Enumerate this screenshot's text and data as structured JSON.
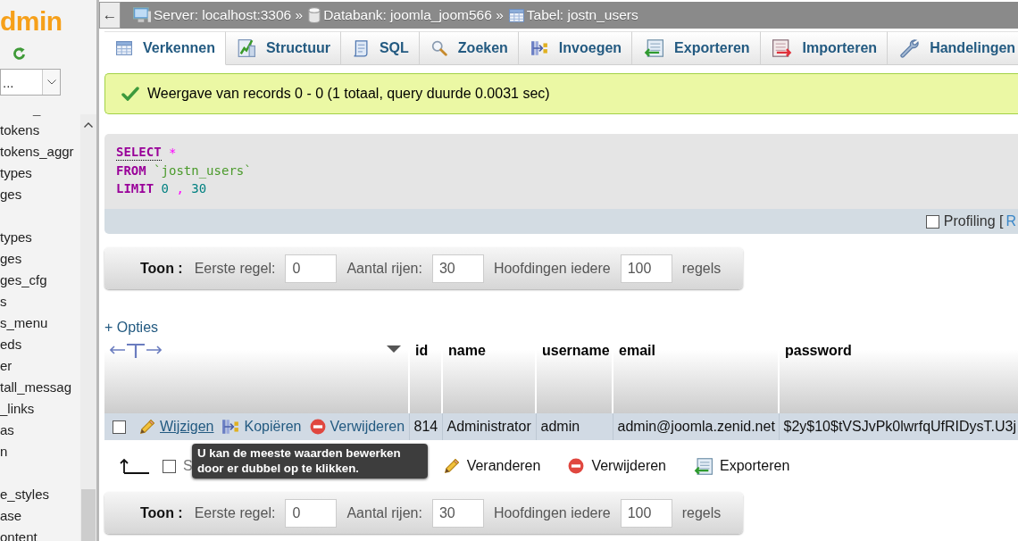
{
  "sidebar": {
    "logo": "dmin",
    "database_select": {
      "value": "..."
    },
    "tree_toggle": "_",
    "table_groups": [
      {
        "items": [
          "tokens",
          "tokens_aggr",
          "types",
          "ges"
        ]
      },
      {
        "items": [
          "types",
          "ges",
          "ges_cfg",
          "s",
          "s_menu",
          "eds",
          "er",
          "tall_messag",
          "_links",
          "as",
          "n"
        ]
      },
      {
        "items": [
          "e_styles",
          "ase",
          "ontent"
        ]
      }
    ]
  },
  "breadcrumb": {
    "back": "←",
    "items": [
      {
        "kind": "server",
        "label": "Server: localhost:3306 »"
      },
      {
        "kind": "database",
        "label": "Databank: joomla_joom566 »"
      },
      {
        "kind": "table",
        "label": "Tabel: jostn_users"
      }
    ]
  },
  "tabs": [
    {
      "kind": "browse",
      "label": "Verkennen",
      "selected": true
    },
    {
      "kind": "structure",
      "label": "Structuur",
      "selected": false
    },
    {
      "kind": "sql",
      "label": "SQL",
      "selected": false
    },
    {
      "kind": "search",
      "label": "Zoeken",
      "selected": false
    },
    {
      "kind": "insert",
      "label": "Invoegen",
      "selected": false
    },
    {
      "kind": "export",
      "label": "Exporteren",
      "selected": false
    },
    {
      "kind": "import",
      "label": "Importeren",
      "selected": false
    },
    {
      "kind": "operations",
      "label": "Handelingen",
      "selected": false
    }
  ],
  "message": {
    "kind": "success",
    "text": "Weergave van records 0 - 0 (1 totaal, query duurde 0.0031 sec)"
  },
  "sql_query": {
    "lines": [
      [
        {
          "kind": "keyword_link",
          "text": "SELECT"
        },
        {
          "kind": "operator",
          "text": "*"
        }
      ],
      [
        {
          "kind": "keyword",
          "text": "FROM"
        },
        {
          "kind": "identifier",
          "text": "`jostn_users`"
        }
      ],
      [
        {
          "kind": "keyword",
          "text": "LIMIT"
        },
        {
          "kind": "number",
          "text": "0"
        },
        {
          "kind": "punctuation",
          "text": ","
        },
        {
          "kind": "number",
          "text": "30"
        }
      ]
    ],
    "profiling": {
      "checked": false,
      "label": "Profiling [",
      "link": "R"
    }
  },
  "top_navigation": {
    "title": "Toon :",
    "fields": [
      {
        "label": "Eerste regel:",
        "value": "0"
      },
      {
        "label": "Aantal rijen:",
        "value": "30"
      },
      {
        "label": "Hoofdingen iedere",
        "value": "100"
      }
    ],
    "suffix": "regels"
  },
  "options_link": "+ Opties",
  "table": {
    "columns": [
      "id",
      "name",
      "username",
      "email",
      "password"
    ],
    "rows": [
      {
        "checked": false,
        "actions": [
          {
            "kind": "edit",
            "label": "Wijzigen",
            "hovered": true
          },
          {
            "kind": "copy",
            "label": "Kopiëren",
            "hovered": false
          },
          {
            "kind": "delete",
            "label": "Verwijderen",
            "hovered": false
          }
        ],
        "cells": [
          "814",
          "Administrator",
          "admin",
          "admin@joomla.zenid.net",
          "$2y$10$tVSJvPk0lwrfqUfRIDysT.U3j"
        ]
      }
    ]
  },
  "bulk_actions": {
    "select_all": {
      "label": "S",
      "checked": false
    },
    "actions": [
      {
        "kind": "edit",
        "label": "Veranderen"
      },
      {
        "kind": "delete",
        "label": "Verwijderen"
      },
      {
        "kind": "export",
        "label": "Exporteren"
      }
    ]
  },
  "tooltip": {
    "text": "U kan de meeste waarden bewerken door er dubbel op te klikken."
  },
  "bottom_navigation": {
    "title": "Toon :",
    "fields": [
      {
        "label": "Eerste regel:",
        "value": "0"
      },
      {
        "label": "Aantal rijen:",
        "value": "30"
      },
      {
        "label": "Hoofdingen iedere",
        "value": "100"
      }
    ],
    "suffix": "regels"
  }
}
